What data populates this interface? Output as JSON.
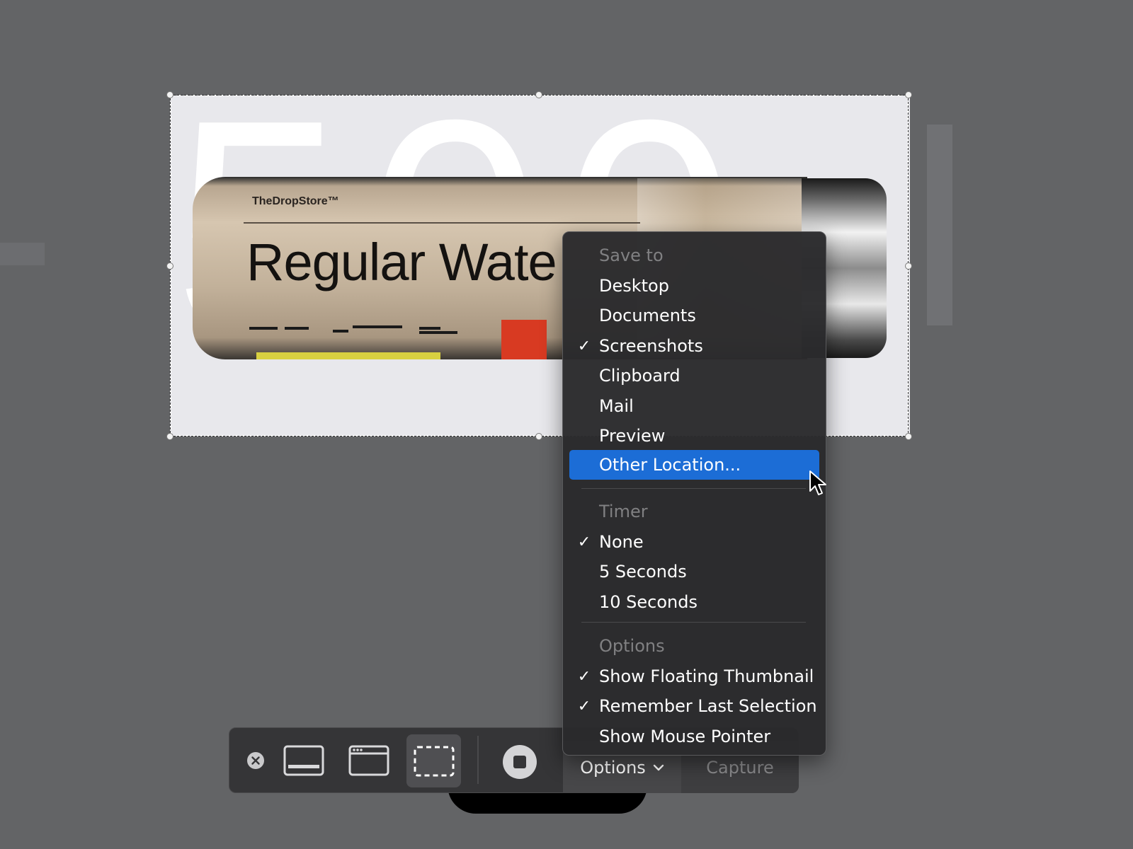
{
  "background": {
    "big_number": "500",
    "bottle": {
      "brand": "TheDropStore™",
      "product_name": "Regular Wate"
    }
  },
  "toolbar": {
    "close_label": "✕",
    "options_label": "Options",
    "capture_label": "Capture",
    "icons": [
      "close-icon",
      "capture-entire-screen-icon",
      "capture-window-icon",
      "capture-selection-icon",
      "record-icon",
      "chevron-down-icon"
    ]
  },
  "menu": {
    "save_to": {
      "header": "Save to",
      "items": [
        {
          "label": "Desktop",
          "checked": false
        },
        {
          "label": "Documents",
          "checked": false
        },
        {
          "label": "Screenshots",
          "checked": true
        },
        {
          "label": "Clipboard",
          "checked": false
        },
        {
          "label": "Mail",
          "checked": false
        },
        {
          "label": "Preview",
          "checked": false
        },
        {
          "label": "Other Location...",
          "checked": false,
          "highlighted": true
        }
      ]
    },
    "timer": {
      "header": "Timer",
      "items": [
        {
          "label": "None",
          "checked": true
        },
        {
          "label": "5 Seconds",
          "checked": false
        },
        {
          "label": "10 Seconds",
          "checked": false
        }
      ]
    },
    "options": {
      "header": "Options",
      "items": [
        {
          "label": "Show Floating Thumbnail",
          "checked": true
        },
        {
          "label": "Remember Last Selection",
          "checked": true
        },
        {
          "label": "Show Mouse Pointer",
          "checked": false
        }
      ]
    },
    "check_glyph": "✓"
  },
  "colors": {
    "desktop": "#636466",
    "menu_highlight": "#1c6dd6",
    "menu_bg": "#2a2a2c"
  }
}
